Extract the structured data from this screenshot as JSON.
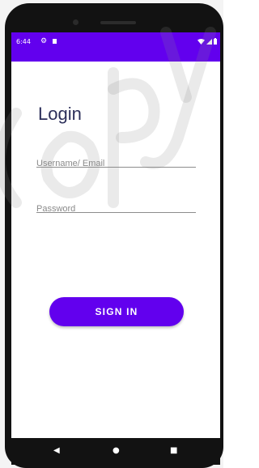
{
  "status_bar": {
    "time": "6:44",
    "settings_icon": "gear-icon",
    "sd_icon": "sd-card-icon",
    "wifi_icon": "wifi-icon",
    "signal_icon": "cell-signal-icon",
    "battery_icon": "battery-icon"
  },
  "login": {
    "title": "Login",
    "username_placeholder": "Username/ Email",
    "password_placeholder": "Password",
    "signin_label": "SIGN IN"
  },
  "nav": {
    "back": "◀",
    "home": "●",
    "recent": "■"
  },
  "colors": {
    "primary": "#6200ee",
    "title": "#2c2f5a"
  }
}
